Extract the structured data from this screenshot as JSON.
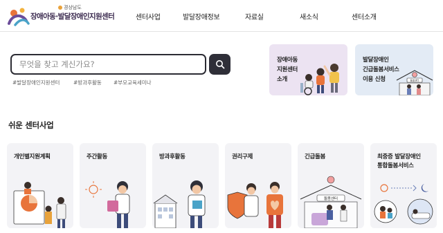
{
  "header": {
    "logo_region": "경상남도",
    "logo_name": "장애아동·발달장애인지원센터",
    "nav": [
      "센터사업",
      "발달장애정보",
      "자료실",
      "새소식",
      "센터소개"
    ]
  },
  "search": {
    "placeholder": "무엇을 찾고 계신가요?",
    "button_icon": "search-icon",
    "tags": [
      "#발달장애인지원센터",
      "#방과후활동",
      "#부모교육세미나"
    ]
  },
  "promos": [
    {
      "lines": [
        "장애아동",
        "지원센터",
        "소개"
      ]
    },
    {
      "lines": [
        "발달장애인",
        "긴급돌봄서비스",
        "이용 신청"
      ],
      "sign": "돌봄센터"
    }
  ],
  "section": {
    "title": "쉬운 센터사업",
    "cards": [
      {
        "lines": [
          "개인별지원계획"
        ]
      },
      {
        "lines": [
          "주간활동"
        ]
      },
      {
        "lines": [
          "방과후활동"
        ]
      },
      {
        "lines": [
          "권리구제"
        ]
      },
      {
        "lines": [
          "긴급돌봄"
        ],
        "sign": "돌봄센터"
      },
      {
        "lines": [
          "최중증 발달장애인",
          "통합돌봄서비스"
        ]
      }
    ]
  },
  "colors": {
    "nav_text": "#222222",
    "search_border": "#2b2b33",
    "search_button": "#2f2f38",
    "promo_purple": "#ece3f2",
    "promo_blue": "#e3ebf5",
    "card_bg": "#f3f3f6"
  }
}
